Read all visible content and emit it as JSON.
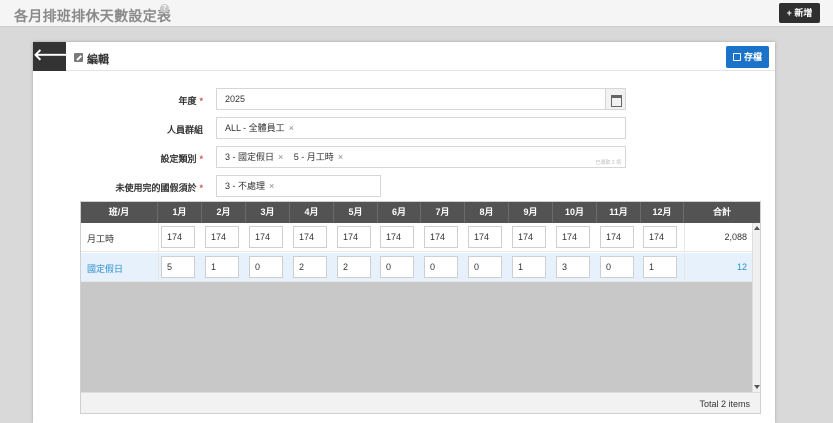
{
  "topbar": {
    "title": "各月排班排休天數設定表",
    "help": "?",
    "add_label": "+ 新增"
  },
  "panel": {
    "back": "🡐",
    "title": "編輯",
    "save_label": "存檔"
  },
  "form": {
    "year": {
      "label": "年度",
      "required": "*",
      "value": "2025"
    },
    "group": {
      "label": "人員群組",
      "tags": [
        "ALL - 全體員工"
      ]
    },
    "category": {
      "label": "設定類別",
      "required": "*",
      "tags": [
        "3 - 國定假日",
        "5 - 月工時"
      ],
      "hint": "已選取 2 項"
    },
    "unused": {
      "label": "未使用完的國假須於",
      "required": "*",
      "tags": [
        "3 - 不處理"
      ]
    },
    "remove": "×"
  },
  "grid": {
    "headers": [
      "班/月",
      "1月",
      "2月",
      "3月",
      "4月",
      "5月",
      "6月",
      "7月",
      "8月",
      "9月",
      "10月",
      "11月",
      "12月",
      "合計"
    ],
    "rows": [
      {
        "label": "月工時",
        "values": [
          "174",
          "174",
          "174",
          "174",
          "174",
          "174",
          "174",
          "174",
          "174",
          "174",
          "174",
          "174"
        ],
        "total": "2,088"
      },
      {
        "label": "國定假日",
        "values": [
          "5",
          "1",
          "0",
          "2",
          "2",
          "0",
          "0",
          "0",
          "1",
          "3",
          "0",
          "1"
        ],
        "total": "12"
      }
    ],
    "footer": "Total 2 items"
  }
}
